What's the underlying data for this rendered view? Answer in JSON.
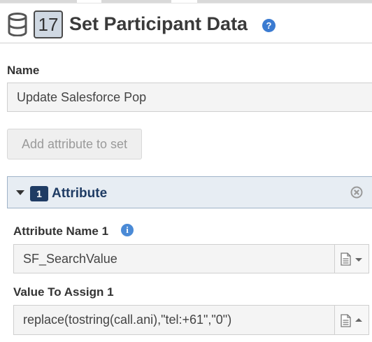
{
  "header": {
    "step_number": "17",
    "title": "Set Participant Data",
    "help_glyph": "?"
  },
  "name_section": {
    "label": "Name",
    "value": "Update Salesforce Pop"
  },
  "add_attribute_button": "Add attribute to set",
  "attribute_panel": {
    "count": "1",
    "title": "Attribute"
  },
  "attribute_name": {
    "label": "Attribute Name 1",
    "info_glyph": "i",
    "value": "SF_SearchValue"
  },
  "value_to_assign": {
    "label": "Value To Assign 1",
    "value": "replace(tostring(call.ani),\"tel:+61\",\"0\")"
  },
  "colors": {
    "accent": "#1f3c64",
    "help": "#3b7bd1",
    "info": "#4a8ad6",
    "panel_bg": "#e7edf3"
  },
  "icons": [
    "database-icon",
    "help-icon",
    "caret-down-icon",
    "remove-icon",
    "info-icon",
    "document-icon",
    "chevron-down-icon",
    "chevron-up-icon"
  ]
}
